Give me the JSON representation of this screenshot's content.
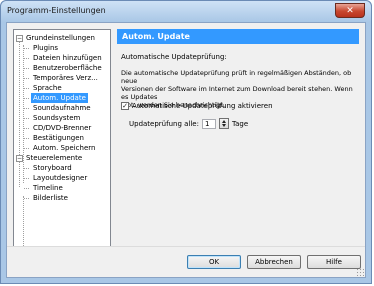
{
  "window": {
    "title": "Programm-Einstellungen",
    "close_label": "✕"
  },
  "tree": {
    "groups": [
      {
        "label": "Grundeinstellungen",
        "toggle": "−",
        "items": [
          "Plugins",
          "Dateien hinzufügen",
          "Benutzeroberfläche",
          "Temporäres Verz...",
          "Sprache",
          "Autom. Update",
          "Soundaufnahme",
          "Soundsystem",
          "CD/DVD-Brenner",
          "Bestätigungen",
          "Autom. Speichern"
        ]
      },
      {
        "label": "Steuerelemente",
        "toggle": "−",
        "items": [
          "Storyboard",
          "Layoutdesigner",
          "Timeline",
          "Bilderliste"
        ]
      }
    ],
    "selected": "Autom. Update"
  },
  "panel": {
    "header": "Autom. Update",
    "section_title": "Automatische Updateprüfung:",
    "description": "Die automatische Updateprüfung prüft in regelmäßigen Abständen, ob neue\nVersionen der Software im Internet zum Download bereit stehen. Wenn es Updates\ngibt, werden Sie benachrichtigt.",
    "checkbox_label": "Automatische Updateprüfung aktivieren",
    "checkbox_checked": true,
    "check_mark": "✓",
    "interval_label": "Updateprüfung alle:",
    "interval_value": "1",
    "interval_unit": "Tage"
  },
  "footer": {
    "ok_label": "OK",
    "cancel_label": "Abbrechen",
    "help_label": "Hilfe"
  },
  "colors": {
    "accent": "#3399ff",
    "frame": "#a9c7e6",
    "close": "#c8472f"
  }
}
